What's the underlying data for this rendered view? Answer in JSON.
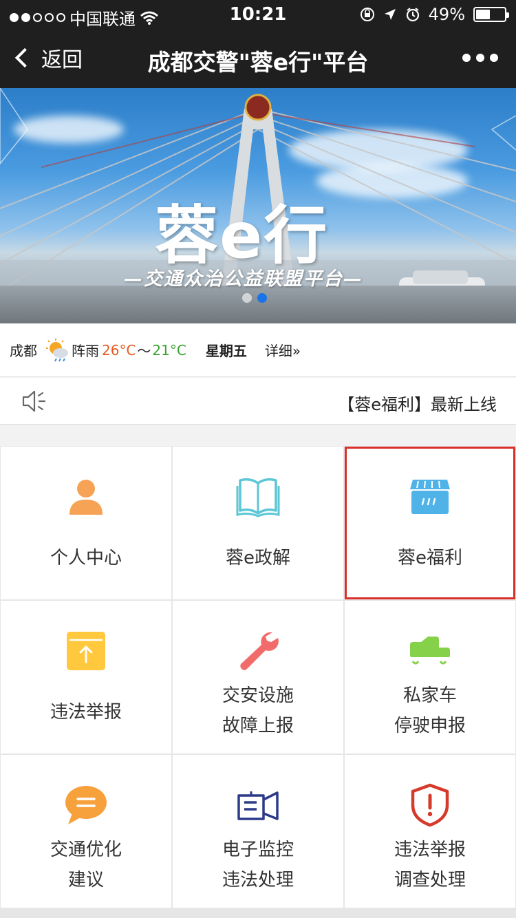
{
  "status_bar": {
    "carrier": "中国联通",
    "time": "10:21",
    "battery_text": "49%",
    "battery_level": 0.49
  },
  "nav": {
    "back_label": "返回",
    "title": "成都交警\"蓉e行\"平台"
  },
  "banner": {
    "logo_text": "蓉e行",
    "slogan": "—交通众治公益联盟平台—",
    "page_count": 2,
    "active_page": 2
  },
  "weather": {
    "city": "成都",
    "condition": "阵雨",
    "high": "26°C",
    "separator": "～",
    "low": "21°C",
    "weekday": "星期五",
    "detail_link": "详细»"
  },
  "notice": {
    "text": "【蓉e福利】最新上线"
  },
  "grid": {
    "items": [
      {
        "label1": "个人中心",
        "label2": "",
        "icon": "person-icon",
        "color": "#f7a356"
      },
      {
        "label1": "蓉e政解",
        "label2": "",
        "icon": "book-icon",
        "color": "#5bc6d6"
      },
      {
        "label1": "蓉e福利",
        "label2": "",
        "icon": "store-icon",
        "color": "#4fb3e8"
      },
      {
        "label1": "违法举报",
        "label2": "",
        "icon": "upload-box-icon",
        "color": "#ffc83d"
      },
      {
        "label1": "交安设施",
        "label2": "故障上报",
        "icon": "wrench-icon",
        "color": "#f26b6b"
      },
      {
        "label1": "私家车",
        "label2": "停驶申报",
        "icon": "car-icon",
        "color": "#86d14a"
      },
      {
        "label1": "交通优化",
        "label2": "建议",
        "icon": "chat-bubble-icon",
        "color": "#f6a13c"
      },
      {
        "label1": "电子监控",
        "label2": "违法处理",
        "icon": "camera-icon",
        "color": "#2c3a8a"
      },
      {
        "label1": "违法举报",
        "label2": "调查处理",
        "icon": "shield-alert-icon",
        "color": "#d63a2a"
      }
    ]
  }
}
